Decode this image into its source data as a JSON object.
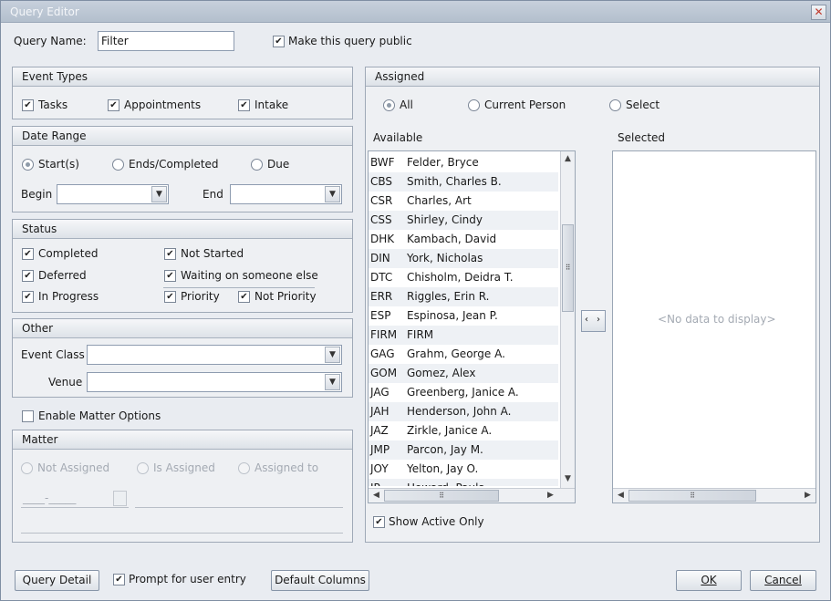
{
  "window": {
    "title": "Query Editor",
    "close_label": "✕"
  },
  "query_name": {
    "label": "Query Name:",
    "value": "Filter"
  },
  "make_public": {
    "label": "Make this query public",
    "checked": true
  },
  "event_types": {
    "header": "Event Types",
    "items": [
      {
        "label": "Tasks",
        "checked": true
      },
      {
        "label": "Appointments",
        "checked": true
      },
      {
        "label": "Intake",
        "checked": true
      }
    ]
  },
  "date_range": {
    "header": "Date Range",
    "options": [
      {
        "label": "Start(s)",
        "selected": true
      },
      {
        "label": "Ends/Completed",
        "selected": false
      },
      {
        "label": "Due",
        "selected": false
      }
    ],
    "begin_label": "Begin",
    "end_label": "End"
  },
  "status": {
    "header": "Status",
    "items": [
      {
        "label": "Completed",
        "checked": true
      },
      {
        "label": "Not Started",
        "checked": true
      },
      {
        "label": "Deferred",
        "checked": true
      },
      {
        "label": "Waiting on someone else",
        "checked": true
      },
      {
        "label": "In Progress",
        "checked": true
      },
      {
        "label": "Priority",
        "checked": true
      },
      {
        "label": "Not Priority",
        "checked": true
      }
    ]
  },
  "other": {
    "header": "Other",
    "event_class_label": "Event Class",
    "venue_label": "Venue"
  },
  "enable_matter": {
    "label": "Enable Matter Options",
    "checked": false
  },
  "matter": {
    "header": "Matter",
    "options": [
      "Not Assigned",
      "Is Assigned",
      "Assigned to"
    ],
    "number_mask": "____-_____"
  },
  "assigned": {
    "header": "Assigned",
    "options": [
      {
        "label": "All",
        "selected": true
      },
      {
        "label": "Current Person",
        "selected": false
      },
      {
        "label": "Select",
        "selected": false
      }
    ],
    "available_label": "Available",
    "selected_label": "Selected",
    "no_data": "<No data to display>",
    "available": [
      {
        "code": "BWF",
        "name": "Felder, Bryce"
      },
      {
        "code": "CBS",
        "name": "Smith, Charles B."
      },
      {
        "code": "CSR",
        "name": "Charles, Art"
      },
      {
        "code": "CSS",
        "name": "Shirley, Cindy"
      },
      {
        "code": "DHK",
        "name": "Kambach, David"
      },
      {
        "code": "DIN",
        "name": "York, Nicholas"
      },
      {
        "code": "DTC",
        "name": "Chisholm, Deidra T."
      },
      {
        "code": "ERR",
        "name": "Riggles, Erin R."
      },
      {
        "code": "ESP",
        "name": "Espinosa, Jean P."
      },
      {
        "code": "FIRM",
        "name": "FIRM"
      },
      {
        "code": "GAG",
        "name": "Grahm, George A."
      },
      {
        "code": "GOM",
        "name": "Gomez, Alex"
      },
      {
        "code": "JAG",
        "name": "Greenberg, Janice A."
      },
      {
        "code": "JAH",
        "name": "Henderson, John A."
      },
      {
        "code": "JAZ",
        "name": "Zirkle, Janice A."
      },
      {
        "code": "JMP",
        "name": "Parcon, Jay M."
      },
      {
        "code": "JOY",
        "name": "Yelton, Jay O."
      },
      {
        "code": "JP",
        "name": "Howard, Paula"
      }
    ],
    "show_active": {
      "label": "Show Active Only",
      "checked": true
    }
  },
  "footer": {
    "query_detail": "Query Detail",
    "prompt": {
      "label": "Prompt for user entry",
      "checked": true
    },
    "default_columns": "Default Columns",
    "ok": "OK",
    "cancel": "Cancel"
  }
}
